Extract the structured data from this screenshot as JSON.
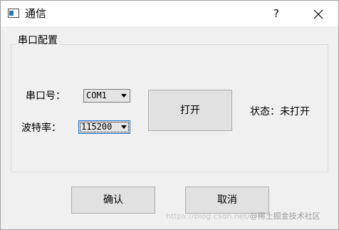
{
  "window": {
    "title": "通信",
    "help_label": "?",
    "icons": {
      "app": "window-app-icon",
      "close": "close-icon"
    }
  },
  "group": {
    "title": "串口配置",
    "port_label": "串口号：",
    "port_value": "COM1",
    "baud_label": "波特率：",
    "baud_value": "115200",
    "open_button": "打开",
    "status_label": "状态：未打开"
  },
  "footer": {
    "confirm_button": "确认",
    "cancel_button": "取消"
  },
  "watermark": {
    "url": "https://blog.csdn.net/",
    "brand": "@稀土掘金技术社区"
  },
  "colors": {
    "titlebar": "#ffffff",
    "background": "#f0f0f0",
    "button_face": "#e1e1e1",
    "combo_focus": "#1e6fd9"
  }
}
